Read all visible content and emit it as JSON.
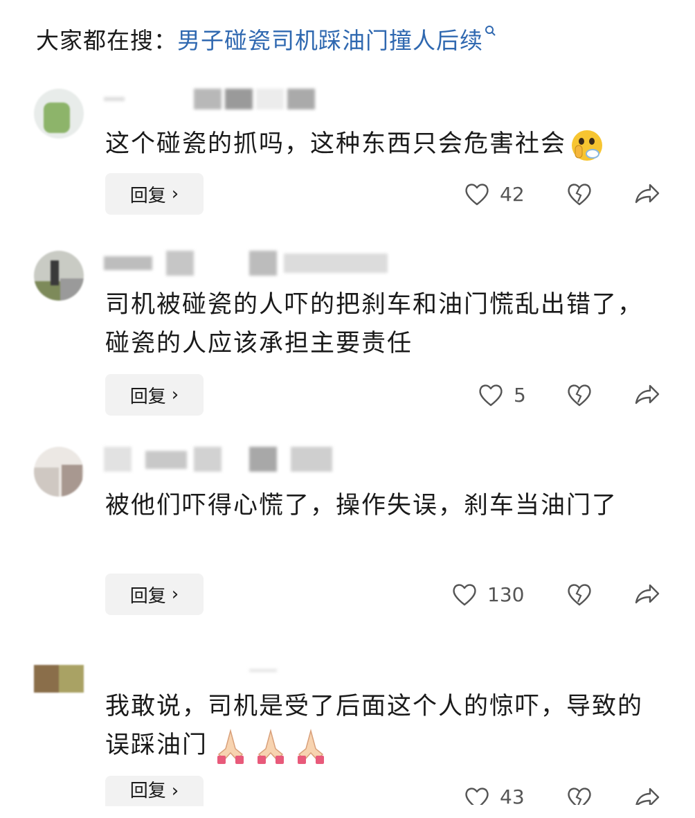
{
  "search": {
    "prefix": "大家都在搜：",
    "term": "男子碰瓷司机踩油门撞人后续",
    "icon": "search-icon"
  },
  "comments": [
    {
      "text": "这个碰瓷的抓吗，这种东西只会危害社会",
      "emoji": "shush-face",
      "reply_label": "回复",
      "likes": "42"
    },
    {
      "text": "司机被碰瓷的人吓的把刹车和油门慌乱出错了，碰瓷的人应该承担主要责任",
      "reply_label": "回复",
      "likes": "5"
    },
    {
      "text": "被他们吓得心慌了，操作失误，刹车当油门了",
      "reply_label": "回复",
      "likes": "130"
    },
    {
      "text": "我敢说，司机是受了后面这个人的惊吓，导致的误踩油门",
      "emoji": "folded-hands x3",
      "reply_label": "回复",
      "likes": "43"
    }
  ],
  "colors": {
    "search_term": "#2f68b0",
    "reply_bg": "#f2f2f2",
    "icon_stroke": "#555555"
  }
}
